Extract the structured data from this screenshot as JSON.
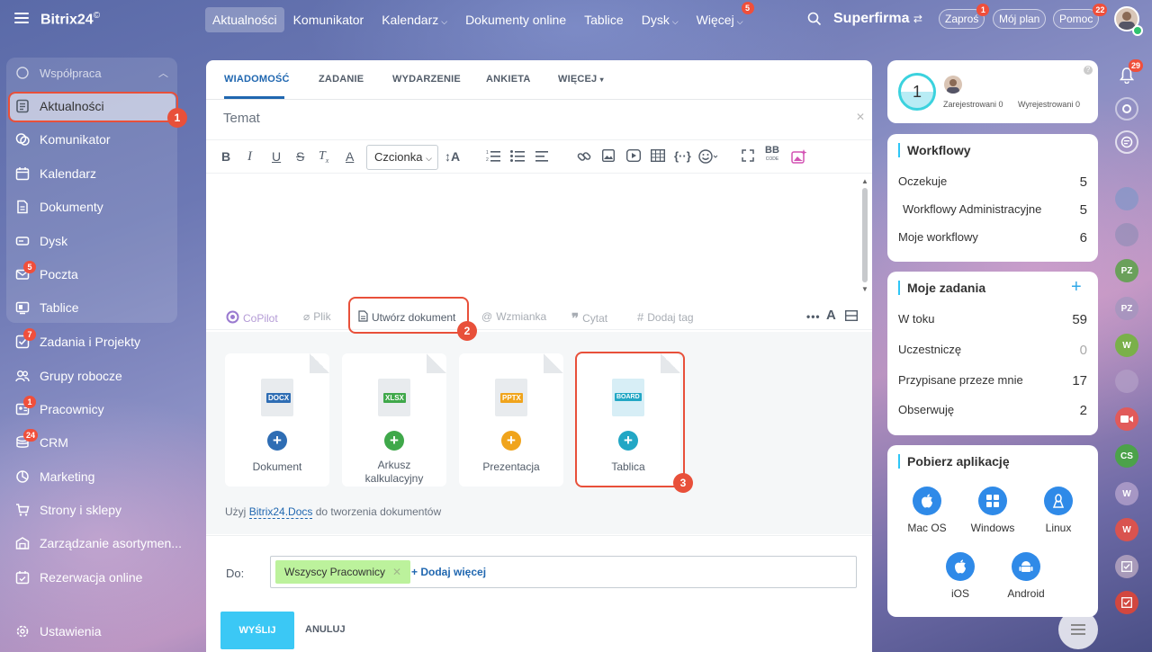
{
  "app": {
    "name": "Bitrix24",
    "mark": "©"
  },
  "topnav": [
    {
      "label": "Aktualności",
      "active": true
    },
    {
      "label": "Komunikator"
    },
    {
      "label": "Kalendarz",
      "chevron": true
    },
    {
      "label": "Dokumenty online"
    },
    {
      "label": "Tablice"
    },
    {
      "label": "Dysk",
      "chevron": true
    },
    {
      "label": "Więcej",
      "chevron": true,
      "badge": "5"
    }
  ],
  "header": {
    "company": "Superfirma",
    "invite": "Zaproś",
    "invite_badge": "1",
    "myplan": "Mój plan",
    "help": "Pomoc",
    "help_badge": "22"
  },
  "sidebar": {
    "group_label": "Współpraca",
    "items": [
      {
        "label": "Aktualności",
        "icon": "news-icon",
        "active": true
      },
      {
        "label": "Komunikator",
        "icon": "chat-icon"
      },
      {
        "label": "Kalendarz",
        "icon": "calendar-icon"
      },
      {
        "label": "Dokumenty",
        "icon": "document-icon"
      },
      {
        "label": "Dysk",
        "icon": "drive-icon"
      },
      {
        "label": "Poczta",
        "icon": "mail-icon",
        "badge": "5"
      },
      {
        "label": "Tablice",
        "icon": "board-icon"
      },
      {
        "label": "Zadania i Projekty",
        "icon": "tasks-icon",
        "badge": "7"
      },
      {
        "label": "Grupy robocze",
        "icon": "groups-icon"
      },
      {
        "label": "Pracownicy",
        "icon": "employees-icon",
        "badge": "1"
      },
      {
        "label": "CRM",
        "icon": "crm-icon",
        "badge": "24"
      },
      {
        "label": "Marketing",
        "icon": "marketing-icon"
      },
      {
        "label": "Strony i sklepy",
        "icon": "shop-icon"
      },
      {
        "label": "Zarządzanie asortymen...",
        "icon": "inventory-icon"
      },
      {
        "label": "Rezerwacja online",
        "icon": "booking-icon"
      }
    ],
    "settings": "Ustawienia"
  },
  "steps": [
    "1",
    "2",
    "3"
  ],
  "composer": {
    "tabs": [
      "WIADOMOŚĆ",
      "ZADANIE",
      "WYDARZENIE",
      "ANKIETA",
      "WIĘCEJ"
    ],
    "subject_placeholder": "Temat",
    "font_select": "Czcionka",
    "toolbar_bb": "BB",
    "toolbar_bb_sub": "CODE",
    "attach": {
      "copilot": "CoPilot",
      "file": "Plik",
      "create_doc": "Utwórz dokument",
      "mention": "Wzmianka",
      "quote": "Cytat",
      "tag": "Dodaj tag"
    },
    "tiles": [
      {
        "label": "Dokument",
        "ext": "DOCX",
        "ext_color": "#2e6db4",
        "plus_color": "#2e6db4"
      },
      {
        "label": "Arkusz kalkulacyjny",
        "ext": "XLSX",
        "ext_color": "#3fa84a",
        "plus_color": "#3fa84a"
      },
      {
        "label": "Prezentacja",
        "ext": "PPTX",
        "ext_color": "#f0a41c",
        "plus_color": "#f0a41c"
      },
      {
        "label": "Tablica",
        "ext": "BOARD",
        "ext_color": "#22a7c5",
        "plus_color": "#22a7c5"
      }
    ],
    "hint_prefix": "Użyj",
    "hint_link": "Bitrix24.Docs",
    "hint_suffix": "do tworzenia dokumentów",
    "to_label": "Do:",
    "recipient": "Wszyscy Pracownicy",
    "add_more": "+ Dodaj więcej",
    "send": "WYŚLIJ",
    "cancel": "ANULUJ"
  },
  "right": {
    "timeman": {
      "count": "1",
      "registered_label": "Zarejestrowani",
      "registered": "0",
      "unregistered_label": "Wyrejestrowani",
      "unregistered": "0"
    },
    "workflow": {
      "title": "Workflowy",
      "rows": [
        {
          "label": "Oczekuje",
          "value": "5"
        },
        {
          "label": "Workflowy Administracyjne",
          "value": "5"
        },
        {
          "label": "Moje workflowy",
          "value": "6"
        }
      ]
    },
    "tasks": {
      "title": "Moje zadania",
      "rows": [
        {
          "label": "W toku",
          "value": "59"
        },
        {
          "label": "Uczestniczę",
          "value": "0"
        },
        {
          "label": "Przypisane przeze mnie",
          "value": "17"
        },
        {
          "label": "Obserwuję",
          "value": "2"
        }
      ]
    },
    "apps": {
      "title": "Pobierz aplikację",
      "items": [
        "Mac OS",
        "Windows",
        "Linux",
        "iOS",
        "Android"
      ]
    }
  },
  "strip": {
    "bell_badge": "29",
    "avatars": [
      "PZ",
      "PZ",
      "W",
      "CS",
      "W",
      "W"
    ]
  }
}
